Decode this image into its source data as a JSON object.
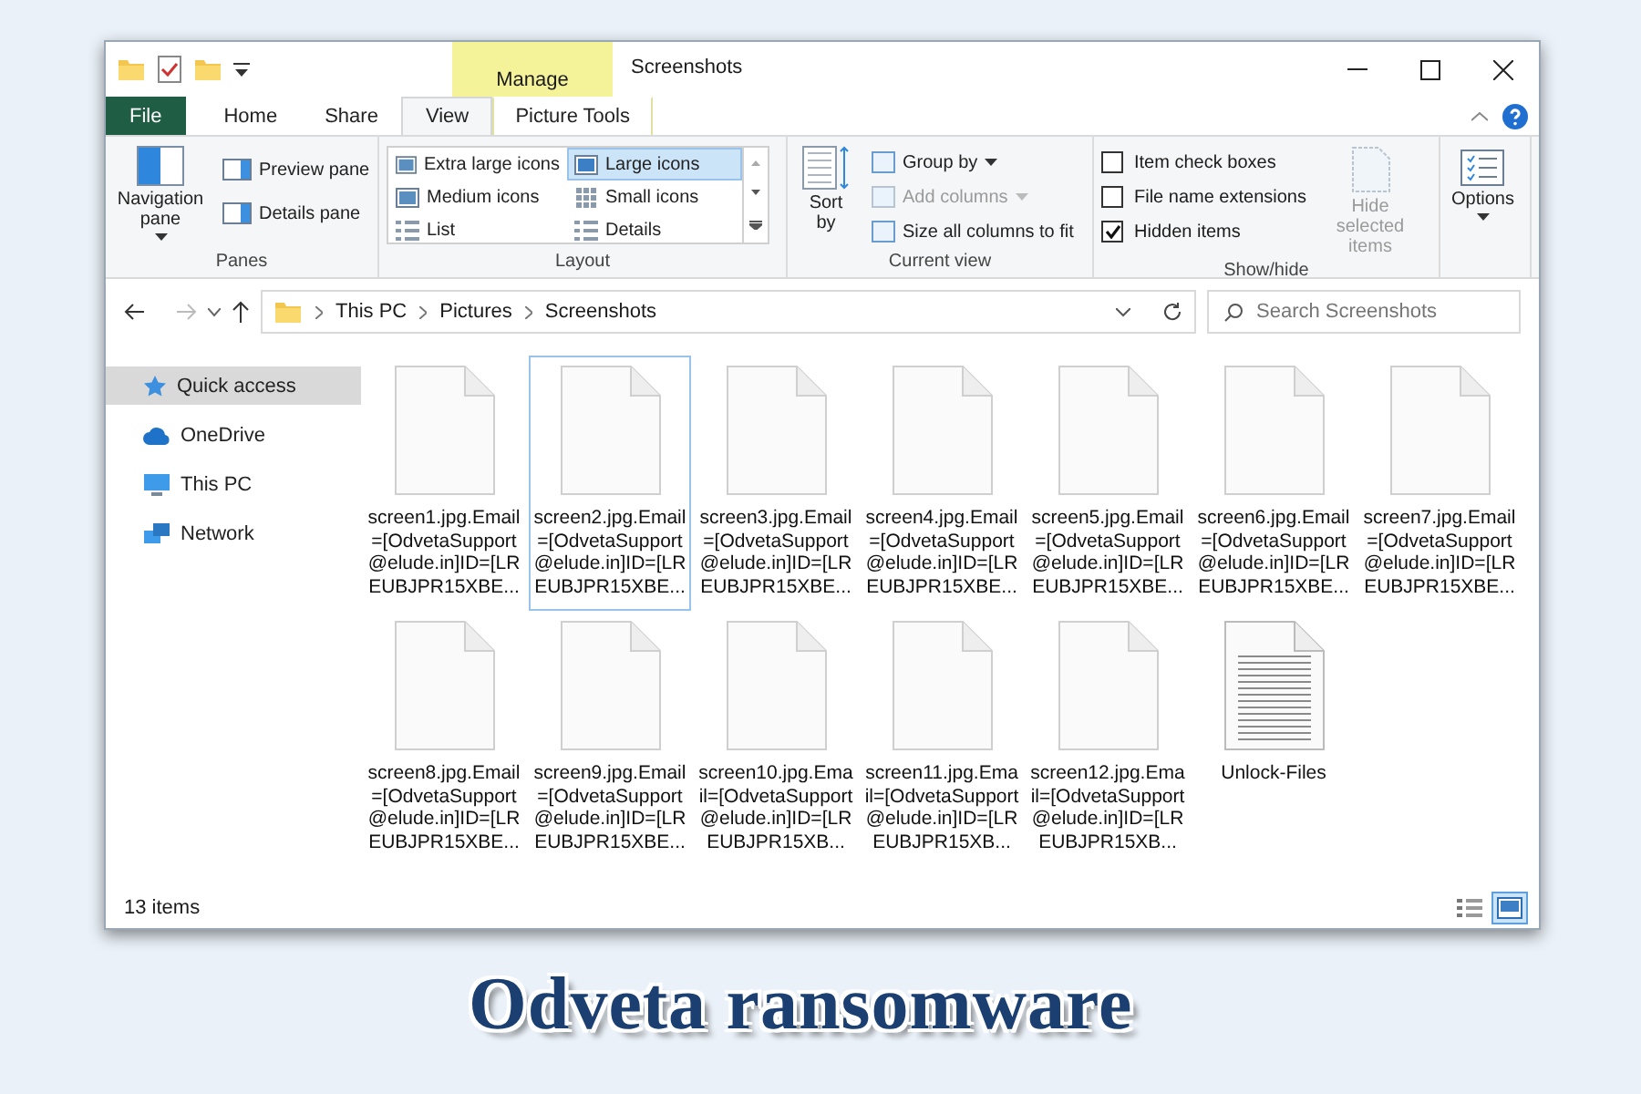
{
  "window": {
    "title": "Screenshots",
    "context_group": "Manage"
  },
  "ribbon_tabs": [
    {
      "label": "File",
      "kind": "file",
      "selected": false
    },
    {
      "label": "Home",
      "kind": "tab",
      "selected": false
    },
    {
      "label": "Share",
      "kind": "tab",
      "selected": false
    },
    {
      "label": "View",
      "kind": "tab",
      "selected": true
    },
    {
      "label": "Picture Tools",
      "kind": "context",
      "selected": false
    }
  ],
  "panes": {
    "label": "Panes",
    "navigation": "Navigation pane",
    "buttons": [
      "Preview pane",
      "Details pane"
    ]
  },
  "layout": {
    "label": "Layout",
    "options": [
      {
        "label": "Extra large icons",
        "selected": false
      },
      {
        "label": "Large icons",
        "selected": true
      },
      {
        "label": "Medium icons",
        "selected": false
      },
      {
        "label": "Small icons",
        "selected": false
      },
      {
        "label": "List",
        "selected": false
      },
      {
        "label": "Details",
        "selected": false
      }
    ]
  },
  "current_view": {
    "label": "Current view",
    "sort": "Sort by",
    "commands": [
      {
        "label": "Group by",
        "disabled": false
      },
      {
        "label": "Add columns",
        "disabled": true
      },
      {
        "label": "Size all columns to fit",
        "disabled": false
      }
    ]
  },
  "show_hide": {
    "label": "Show/hide",
    "checkboxes": [
      {
        "label": "Item check boxes",
        "checked": false
      },
      {
        "label": "File name extensions",
        "checked": false
      },
      {
        "label": "Hidden items",
        "checked": true
      }
    ],
    "hide_selected": {
      "label": "Hide selected items",
      "disabled": true
    }
  },
  "options": {
    "label": "Options"
  },
  "address": {
    "path": [
      "This PC",
      "Pictures",
      "Screenshots"
    ]
  },
  "search": {
    "placeholder": "Search Screenshots"
  },
  "sidebar": {
    "items": [
      {
        "label": "Quick access",
        "kind": "star",
        "selected": true
      },
      {
        "label": "OneDrive",
        "kind": "cloud",
        "selected": false
      },
      {
        "label": "This PC",
        "kind": "pc",
        "selected": false
      },
      {
        "label": "Network",
        "kind": "network",
        "selected": false
      }
    ]
  },
  "files": [
    {
      "name": "screen1.jpg.Email=[OdvetaSupport@elude.in]ID=[LREUBJPR15XBE...",
      "kind": "blank",
      "selected": false
    },
    {
      "name": "screen2.jpg.Email=[OdvetaSupport@elude.in]ID=[LREUBJPR15XBE...",
      "kind": "blank",
      "selected": true
    },
    {
      "name": "screen3.jpg.Email=[OdvetaSupport@elude.in]ID=[LREUBJPR15XBE...",
      "kind": "blank",
      "selected": false
    },
    {
      "name": "screen4.jpg.Email=[OdvetaSupport@elude.in]ID=[LREUBJPR15XBE...",
      "kind": "blank",
      "selected": false
    },
    {
      "name": "screen5.jpg.Email=[OdvetaSupport@elude.in]ID=[LREUBJPR15XBE...",
      "kind": "blank",
      "selected": false
    },
    {
      "name": "screen6.jpg.Email=[OdvetaSupport@elude.in]ID=[LREUBJPR15XBE...",
      "kind": "blank",
      "selected": false
    },
    {
      "name": "screen7.jpg.Email=[OdvetaSupport@elude.in]ID=[LREUBJPR15XBE...",
      "kind": "blank",
      "selected": false
    },
    {
      "name": "screen8.jpg.Email=[OdvetaSupport@elude.in]ID=[LREUBJPR15XBE...",
      "kind": "blank",
      "selected": false
    },
    {
      "name": "screen9.jpg.Email=[OdvetaSupport@elude.in]ID=[LREUBJPR15XBE...",
      "kind": "blank",
      "selected": false
    },
    {
      "name": "screen10.jpg.Email=[OdvetaSupport@elude.in]ID=[LREUBJPR15XB...",
      "kind": "blank",
      "selected": false
    },
    {
      "name": "screen11.jpg.Email=[OdvetaSupport@elude.in]ID=[LREUBJPR15XB...",
      "kind": "blank",
      "selected": false
    },
    {
      "name": "screen12.jpg.Email=[OdvetaSupport@elude.in]ID=[LREUBJPR15XB...",
      "kind": "blank",
      "selected": false
    },
    {
      "name": "Unlock-Files",
      "kind": "text",
      "selected": false
    }
  ],
  "status_bar": {
    "count": "13 items",
    "views": [
      {
        "kind": "details",
        "selected": false
      },
      {
        "kind": "large-icons",
        "selected": true
      }
    ]
  },
  "caption": "Odveta ransomware"
}
